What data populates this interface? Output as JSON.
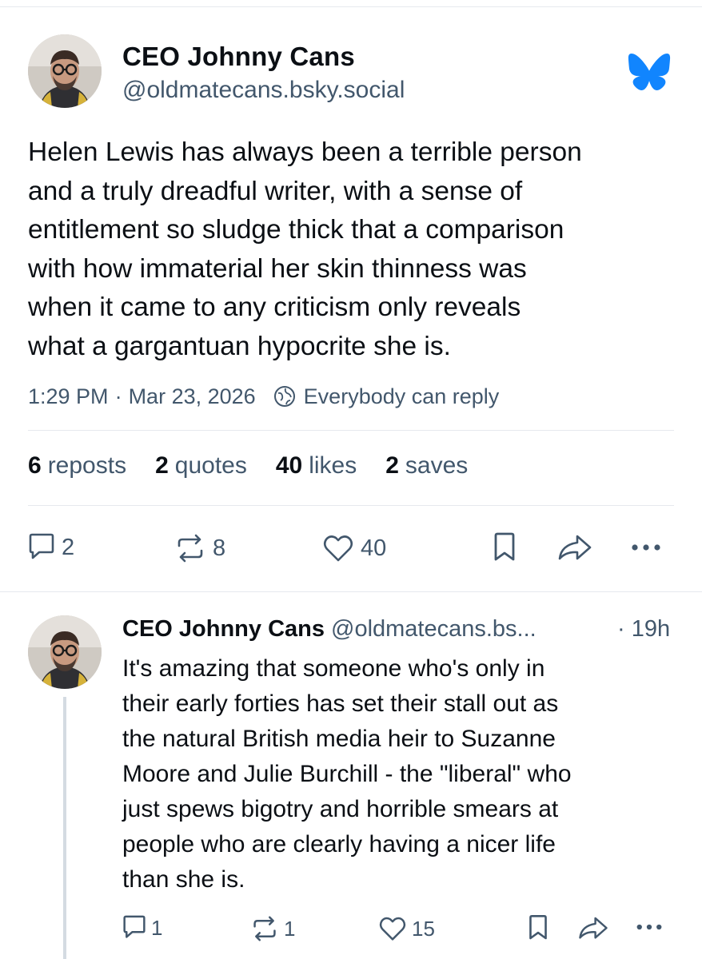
{
  "main_post": {
    "author_name": "CEO Johnny Cans",
    "author_handle": "@oldmatecans.bsky.social",
    "text_lines": [
      "Helen Lewis has always been a terrible person",
      "and a truly dreadful writer, with a sense of",
      "entitlement so sludge thick that a comparison",
      "with how immaterial her skin thinness was",
      "when it came to any criticism only reveals",
      "what a gargantuan hypocrite she is."
    ],
    "time": "1:29 PM",
    "separator": "·",
    "date": "Mar 23, 2026",
    "reply_setting": "Everybody can reply",
    "stats": {
      "reposts_count": "6",
      "reposts_label": "reposts",
      "quotes_count": "2",
      "quotes_label": "quotes",
      "likes_count": "40",
      "likes_label": "likes",
      "saves_count": "2",
      "saves_label": "saves"
    },
    "actions": {
      "reply_count": "2",
      "repost_count": "8",
      "like_count": "40"
    }
  },
  "reply": {
    "author_name": "CEO Johnny Cans",
    "author_handle": "@oldmatecans.bs...",
    "time": "· 19h",
    "text_lines": [
      "It's amazing that someone who's only in",
      "their early forties has set their stall out as",
      "the natural British media heir to Suzanne",
      "Moore and Julie Burchill - the \"liberal\" who",
      "just spews bigotry and horrible smears at",
      "people who are clearly having a nicer life",
      "than she is."
    ],
    "actions": {
      "reply_count": "1",
      "repost_count": "1",
      "like_count": "15"
    }
  },
  "icons": {
    "logo": "bluesky-butterfly-icon",
    "globe": "globe-icon",
    "reply": "speech-bubble-icon",
    "repost": "repost-arrows-icon",
    "like": "heart-icon",
    "bookmark": "bookmark-icon",
    "share": "share-arrow-icon",
    "more": "more-dots-icon"
  },
  "colors": {
    "brand": "#1185fe",
    "text": "#0b0f14",
    "muted": "#42576c",
    "divider": "#e6e9ee"
  }
}
